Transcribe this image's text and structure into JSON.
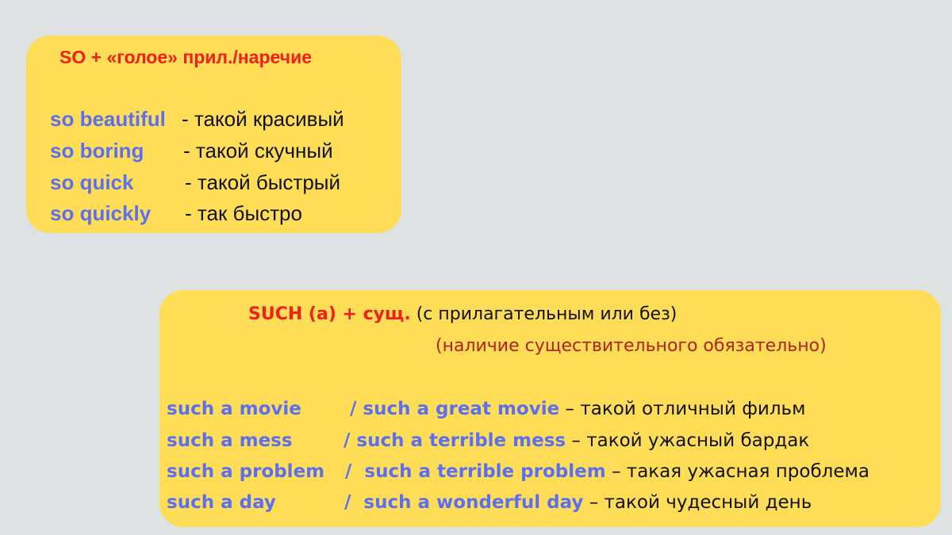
{
  "colors": {
    "background": "#dfe2e2",
    "card": "#ffdd57",
    "heading_red": "#f0201a",
    "note_dark_red": "#b3221a",
    "english_blue": "#5b6ff0",
    "text_black": "#111111"
  },
  "so_card": {
    "title": "SO + «голое» прил./наречие",
    "rows": [
      {
        "en": "so beautiful",
        "ru": "- такой красивый"
      },
      {
        "en": "so boring",
        "ru": "- такой скучный"
      },
      {
        "en": "so quick",
        "ru": "- такой быстрый"
      },
      {
        "en": "so quickly",
        "ru": "- так быстро"
      }
    ]
  },
  "such_card": {
    "title_red": "SUCH (a)  + сущ.",
    "title_black": " (с прилагательным или без)",
    "note": "(наличие существительного обязательно)",
    "rows": [
      {
        "short": "such a movie",
        "sep": "/ ",
        "long": "such a great movie",
        "ru": " – такой отличный фильм"
      },
      {
        "short": "such a mess",
        "sep": "/ ",
        "long": "such a terrible mess",
        "ru": " – такой ужасный бардак"
      },
      {
        "short": "such a problem",
        "sep": "/  ",
        "long": "such a terrible problem",
        "ru": " – такая ужасная проблема"
      },
      {
        "short": "such a day",
        "sep": "/  ",
        "long": "such a wonderful day",
        "ru": " – такой чудесный день"
      }
    ]
  }
}
